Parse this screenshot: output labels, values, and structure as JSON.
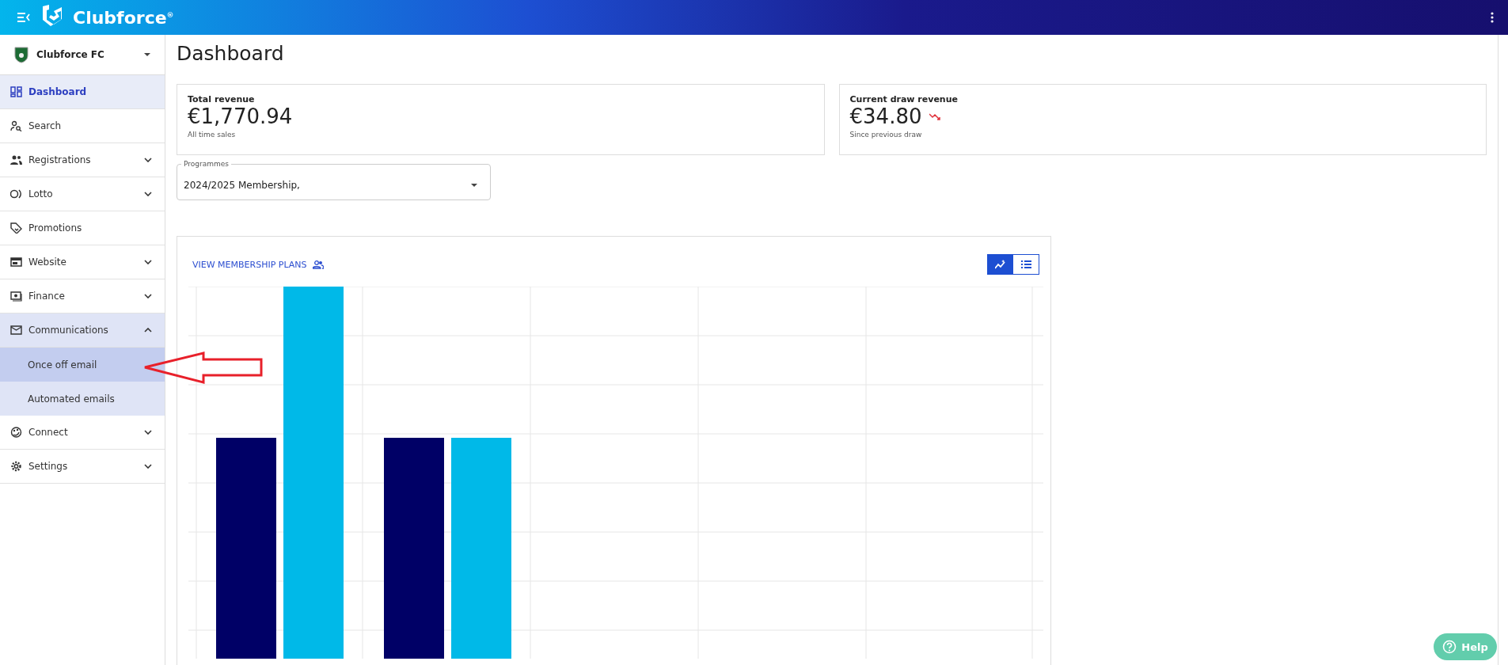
{
  "topbar": {
    "brand": "Clubforce",
    "trademark": "®"
  },
  "sidebar": {
    "club": "Clubforce FC",
    "items": [
      {
        "label": "Dashboard",
        "selected": true
      },
      {
        "label": "Search",
        "selected": false
      },
      {
        "label": "Registrations",
        "selected": false,
        "expanded": false
      },
      {
        "label": "Lotto",
        "selected": false,
        "expanded": false
      },
      {
        "label": "Promotions",
        "selected": false
      },
      {
        "label": "Website",
        "selected": false,
        "expanded": false
      },
      {
        "label": "Finance",
        "selected": false,
        "expanded": false
      },
      {
        "label": "Communications",
        "selected": false,
        "expanded": true,
        "children": [
          {
            "label": "Once off email",
            "selected": true
          },
          {
            "label": "Automated emails",
            "selected": false
          }
        ]
      },
      {
        "label": "Connect",
        "selected": false,
        "expanded": false
      },
      {
        "label": "Settings",
        "selected": false,
        "expanded": false
      }
    ]
  },
  "page": {
    "title": "Dashboard"
  },
  "stats": [
    {
      "label": "Total revenue",
      "value": "€1,770.94",
      "caption": "All time sales"
    },
    {
      "label": "Current draw revenue",
      "value": "€34.80",
      "caption": "Since previous draw"
    }
  ],
  "programmes": {
    "label": "Programmes",
    "value": "2024/2025 Membership,"
  },
  "chart_card": {
    "link": "VIEW MEMBERSHIP PLANS",
    "views": [
      {
        "selected": true
      },
      {
        "selected": false
      }
    ]
  },
  "help": {
    "label": "Help"
  }
}
